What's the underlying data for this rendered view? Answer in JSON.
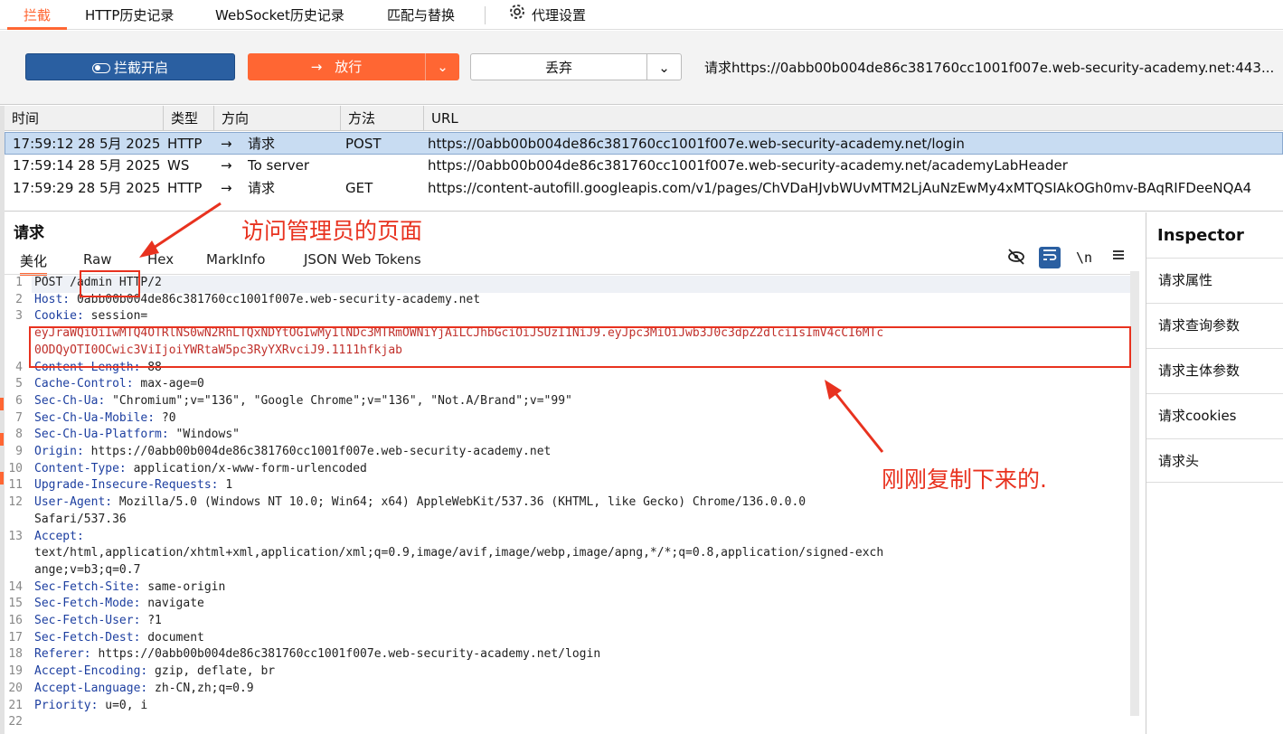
{
  "topnav": {
    "tabs": [
      {
        "label": "拦截"
      },
      {
        "label": "HTTP历史记录"
      },
      {
        "label": "WebSocket历史记录"
      },
      {
        "label": "匹配与替换"
      },
      {
        "label": "代理设置"
      }
    ]
  },
  "toolbar": {
    "intercept_label": "拦截开启",
    "forward_label": "放行",
    "drop_label": "丢弃",
    "request_info": "请求https://0abb00b004de86c381760cc1001f007e.web-security-academy.net:443..."
  },
  "table": {
    "headers": [
      "时间",
      "类型",
      "方向",
      "方法",
      "URL"
    ],
    "rows": [
      {
        "time": "17:59:12 28 5月 2025",
        "type": "HTTP",
        "dir": "请求",
        "method": "POST",
        "url": "https://0abb00b004de86c381760cc1001f007e.web-security-academy.net/login"
      },
      {
        "time": "17:59:14 28 5月 2025",
        "type": "WS",
        "dir": "To server",
        "method": "",
        "url": "https://0abb00b004de86c381760cc1001f007e.web-security-academy.net/academyLabHeader"
      },
      {
        "time": "17:59:29 28 5月 2025",
        "type": "HTTP",
        "dir": "请求",
        "method": "GET",
        "url": "https://content-autofill.googleapis.com/v1/pages/ChVDaHJvbWUvMTM2LjAuNzEwMy4xMTQSIAkOGh0mv-BAqRIFDeeNQA4"
      }
    ]
  },
  "request": {
    "title": "请求",
    "subtabs": [
      "美化",
      "Raw",
      "Hex",
      "MarkInfo",
      "JSON Web Tokens"
    ],
    "newline_label": "\\n",
    "line_numbers": [
      "1",
      "2",
      "3",
      "",
      "",
      "4",
      "5",
      "6",
      "7",
      "8",
      "9",
      "10",
      "11",
      "12",
      "",
      "13",
      "",
      "",
      "14",
      "15",
      "16",
      "17",
      "18",
      "19",
      "20",
      "21",
      "22"
    ],
    "lines": [
      {
        "key": "",
        "val": "POST /admin HTTP/2"
      },
      {
        "key": "Host:",
        "val": " 0abb00b004de86c381760cc1001f007e.web-security-academy.net"
      },
      {
        "key": "Cookie:",
        "val": " session="
      },
      {
        "key": "",
        "val": "eyJraWQiOiIwMTQ4OTRlNS0wN2RhLTQxNDYtOGIwMy1lNDc3MTRmOWNiYjAiLCJhbGciOiJSUzI1NiJ9.eyJpc3MiOiJwb3J0c3dpZ2dlciIsImV4cCI6MTc"
      },
      {
        "key": "",
        "val": "0ODQyOTI0OCwic3ViIjoiYWRtaW5pc3RyYXRvciJ9.1111hfkjab"
      },
      {
        "key": "Content-Length:",
        "val": " 88"
      },
      {
        "key": "Cache-Control:",
        "val": " max-age=0"
      },
      {
        "key": "Sec-Ch-Ua:",
        "val": " \"Chromium\";v=\"136\", \"Google Chrome\";v=\"136\", \"Not.A/Brand\";v=\"99\""
      },
      {
        "key": "Sec-Ch-Ua-Mobile:",
        "val": " ?0"
      },
      {
        "key": "Sec-Ch-Ua-Platform:",
        "val": " \"Windows\""
      },
      {
        "key": "Origin:",
        "val": " https://0abb00b004de86c381760cc1001f007e.web-security-academy.net"
      },
      {
        "key": "Content-Type:",
        "val": " application/x-www-form-urlencoded"
      },
      {
        "key": "Upgrade-Insecure-Requests:",
        "val": " 1"
      },
      {
        "key": "User-Agent:",
        "val": " Mozilla/5.0 (Windows NT 10.0; Win64; x64) AppleWebKit/537.36 (KHTML, like Gecko) Chrome/136.0.0.0"
      },
      {
        "key": "",
        "val": "Safari/537.36"
      },
      {
        "key": "Accept:",
        "val": ""
      },
      {
        "key": "",
        "val": "text/html,application/xhtml+xml,application/xml;q=0.9,image/avif,image/webp,image/apng,*/*;q=0.8,application/signed-exch"
      },
      {
        "key": "",
        "val": "ange;v=b3;q=0.7"
      },
      {
        "key": "Sec-Fetch-Site:",
        "val": " same-origin"
      },
      {
        "key": "Sec-Fetch-Mode:",
        "val": " navigate"
      },
      {
        "key": "Sec-Fetch-User:",
        "val": " ?1"
      },
      {
        "key": "Sec-Fetch-Dest:",
        "val": " document"
      },
      {
        "key": "Referer:",
        "val": " https://0abb00b004de86c381760cc1001f007e.web-security-academy.net/login"
      },
      {
        "key": "Accept-Encoding:",
        "val": " gzip, deflate, br"
      },
      {
        "key": "Accept-Language:",
        "val": " zh-CN,zh;q=0.9"
      },
      {
        "key": "Priority:",
        "val": " u=0, i"
      },
      {
        "key": "",
        "val": ""
      }
    ]
  },
  "inspector": {
    "title": "Inspector",
    "items": [
      "请求属性",
      "请求查询参数",
      "请求主体参数",
      "请求cookies",
      "请求头"
    ]
  },
  "annotations": {
    "admin_note": "访问管理员的页面",
    "cookie_note": "刚刚复制下来的."
  },
  "colors": {
    "accent": "#ff6633",
    "intercept_button": "#2a5fa1",
    "annotation": "#e8321f",
    "selected_row": "#c8dcf2"
  }
}
